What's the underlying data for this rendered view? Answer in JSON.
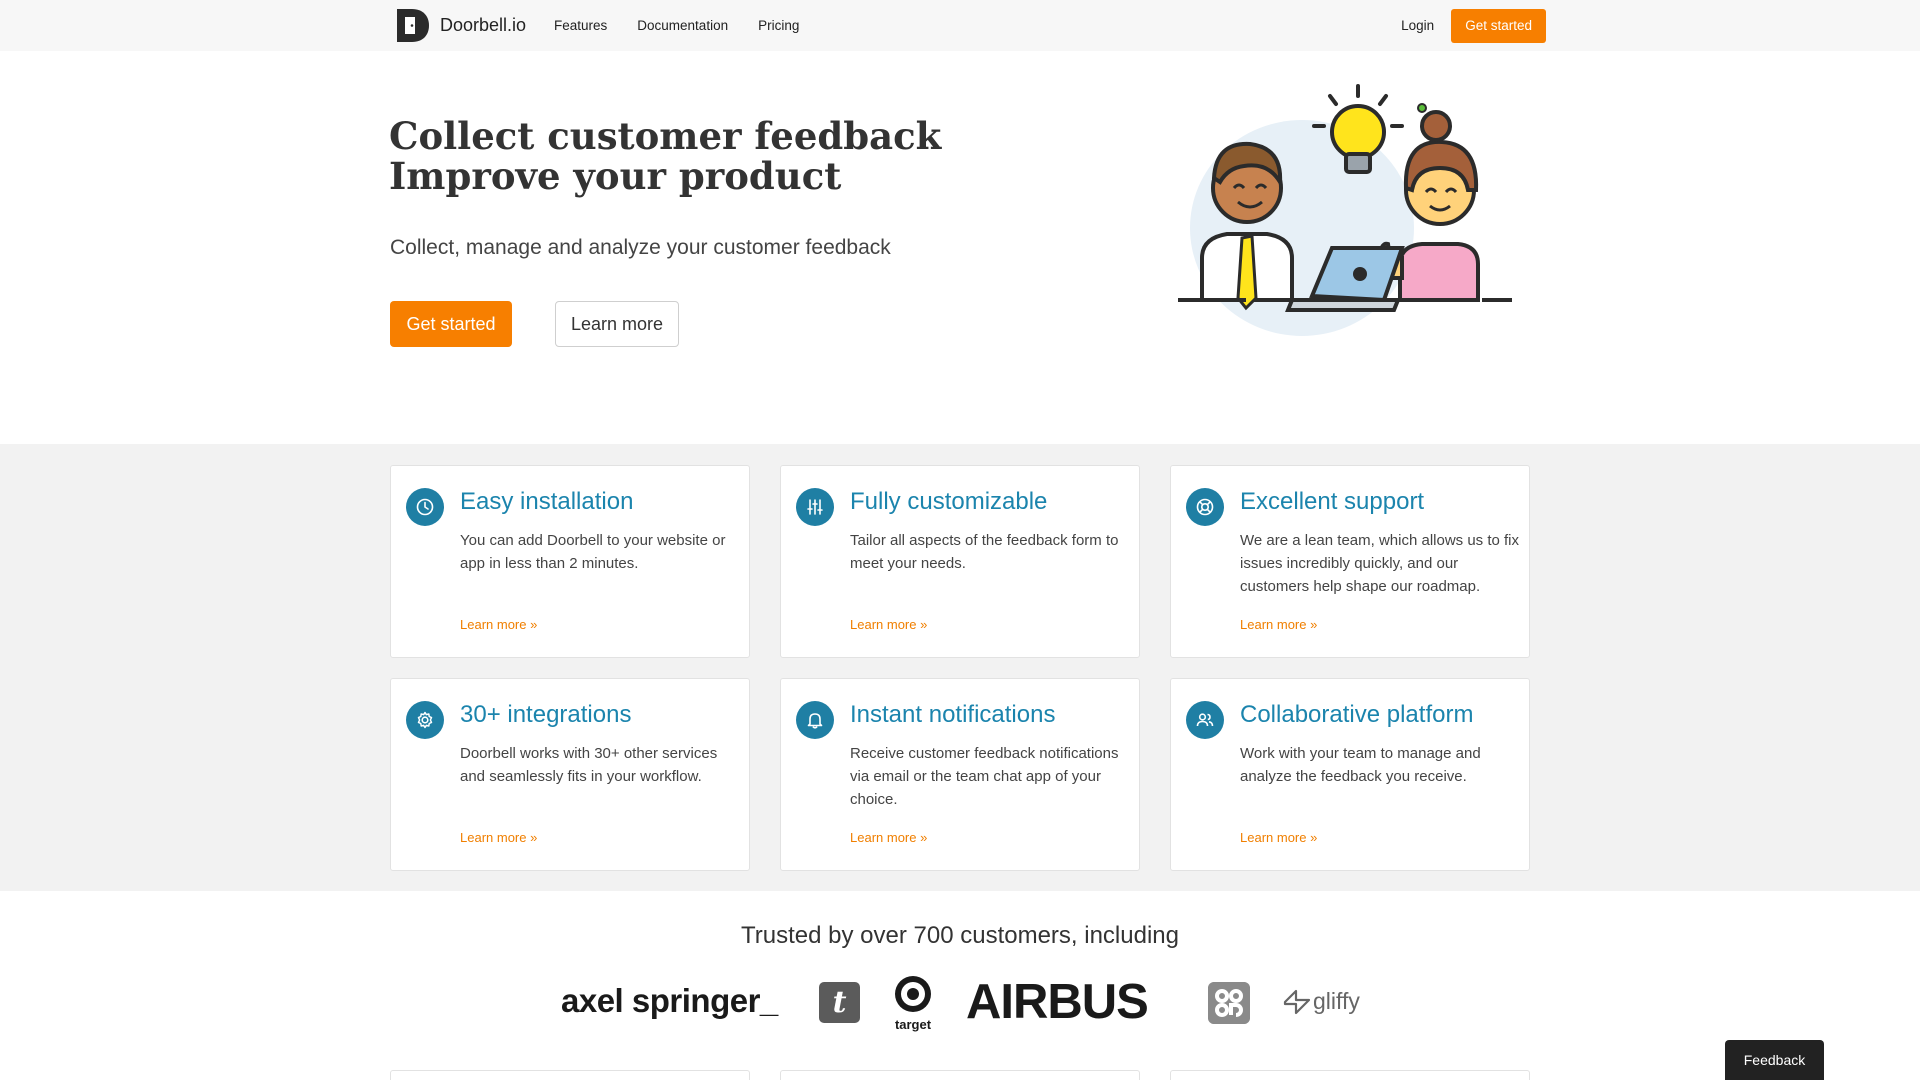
{
  "nav": {
    "brand": "Doorbell.io",
    "links": [
      "Features",
      "Documentation",
      "Pricing"
    ],
    "login": "Login",
    "cta": "Get started"
  },
  "hero": {
    "title_line1": "Collect customer feedback",
    "title_line2": "Improve your product",
    "subtitle": "Collect, manage and analyze your customer feedback",
    "primary_button": "Get started",
    "secondary_button": "Learn more"
  },
  "features": [
    {
      "icon": "clock-icon",
      "title": "Easy installation",
      "desc": "You can add Doorbell to your website or app in less than 2 minutes.",
      "link": "Learn more »"
    },
    {
      "icon": "sliders-icon",
      "title": "Fully customizable",
      "desc": "Tailor all aspects of the feedback form to meet your needs.",
      "link": "Learn more »"
    },
    {
      "icon": "lifebuoy-icon",
      "title": "Excellent support",
      "desc": "We are a lean team, which allows us to fix issues incredibly quickly, and our customers help shape our roadmap.",
      "link": "Learn more »"
    },
    {
      "icon": "gear-icon",
      "title": "30+ integrations",
      "desc": "Doorbell works with 30+ other services and seamlessly fits in your workflow.",
      "link": "Learn more »"
    },
    {
      "icon": "bell-icon",
      "title": "Instant notifications",
      "desc": "Receive customer feedback notifications via email or the team chat app of your choice.",
      "link": "Learn more »"
    },
    {
      "icon": "users-icon",
      "title": "Collaborative platform",
      "desc": "Work with your team to manage and analyze the feedback you receive.",
      "link": "Learn more »"
    }
  ],
  "trusted": {
    "title": "Trusted by over 700 customers, including",
    "logos": [
      "axel springer_",
      "t",
      "target",
      "AIRBUS",
      "coop",
      "gliffy"
    ]
  },
  "feedback_tab": "Feedback",
  "colors": {
    "accent": "#f77f00",
    "feature_blue": "#1f7fa4",
    "nav_bg": "#f7f7f7",
    "features_bg": "#f2f2f2"
  }
}
